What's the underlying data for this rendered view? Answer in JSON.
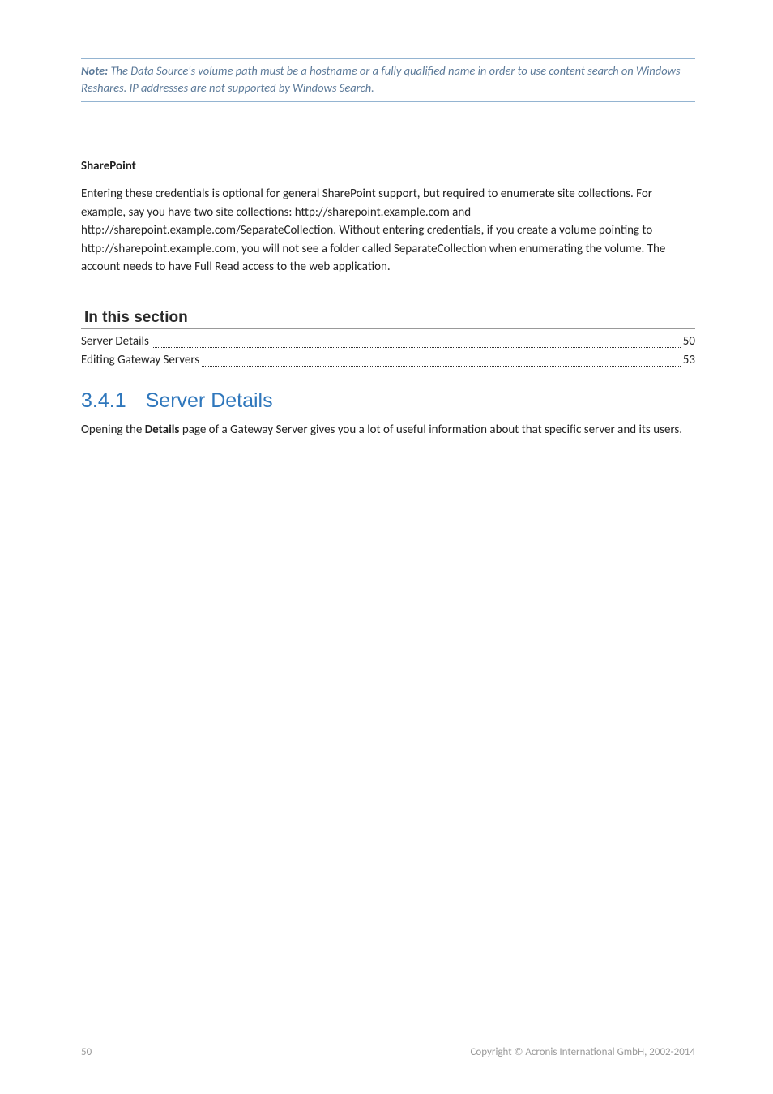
{
  "note": {
    "label": "Note:",
    "text": " The Data Source's volume path must be a hostname or a fully qualified name in order to use content search on Windows Reshares. IP addresses are not supported by Windows Search."
  },
  "sharepoint": {
    "heading": "SharePoint",
    "paragraph": "Entering these credentials is optional for general SharePoint support, but required to enumerate site collections. For example, say you have two site collections: http://sharepoint.example.com and http://sharepoint.example.com/SeparateCollection. Without entering credentials, if you create a volume pointing to http://sharepoint.example.com, you will not see a folder called SeparateCollection when enumerating the volume. The account needs to have Full Read access to the web application."
  },
  "section_heading": "In this section",
  "toc": [
    {
      "title": "Server Details",
      "page": "50"
    },
    {
      "title": "Editing Gateway Servers",
      "page": "53"
    }
  ],
  "subsection": {
    "number": "3.4.1",
    "title": "Server Details",
    "para_pre": "Opening the ",
    "para_bold": "Details",
    "para_post": " page of a Gateway Server gives you a lot of useful information about that specific server and its users."
  },
  "footer": {
    "page_number": "50",
    "copyright": "Copyright © Acronis International GmbH, 2002-2014"
  }
}
